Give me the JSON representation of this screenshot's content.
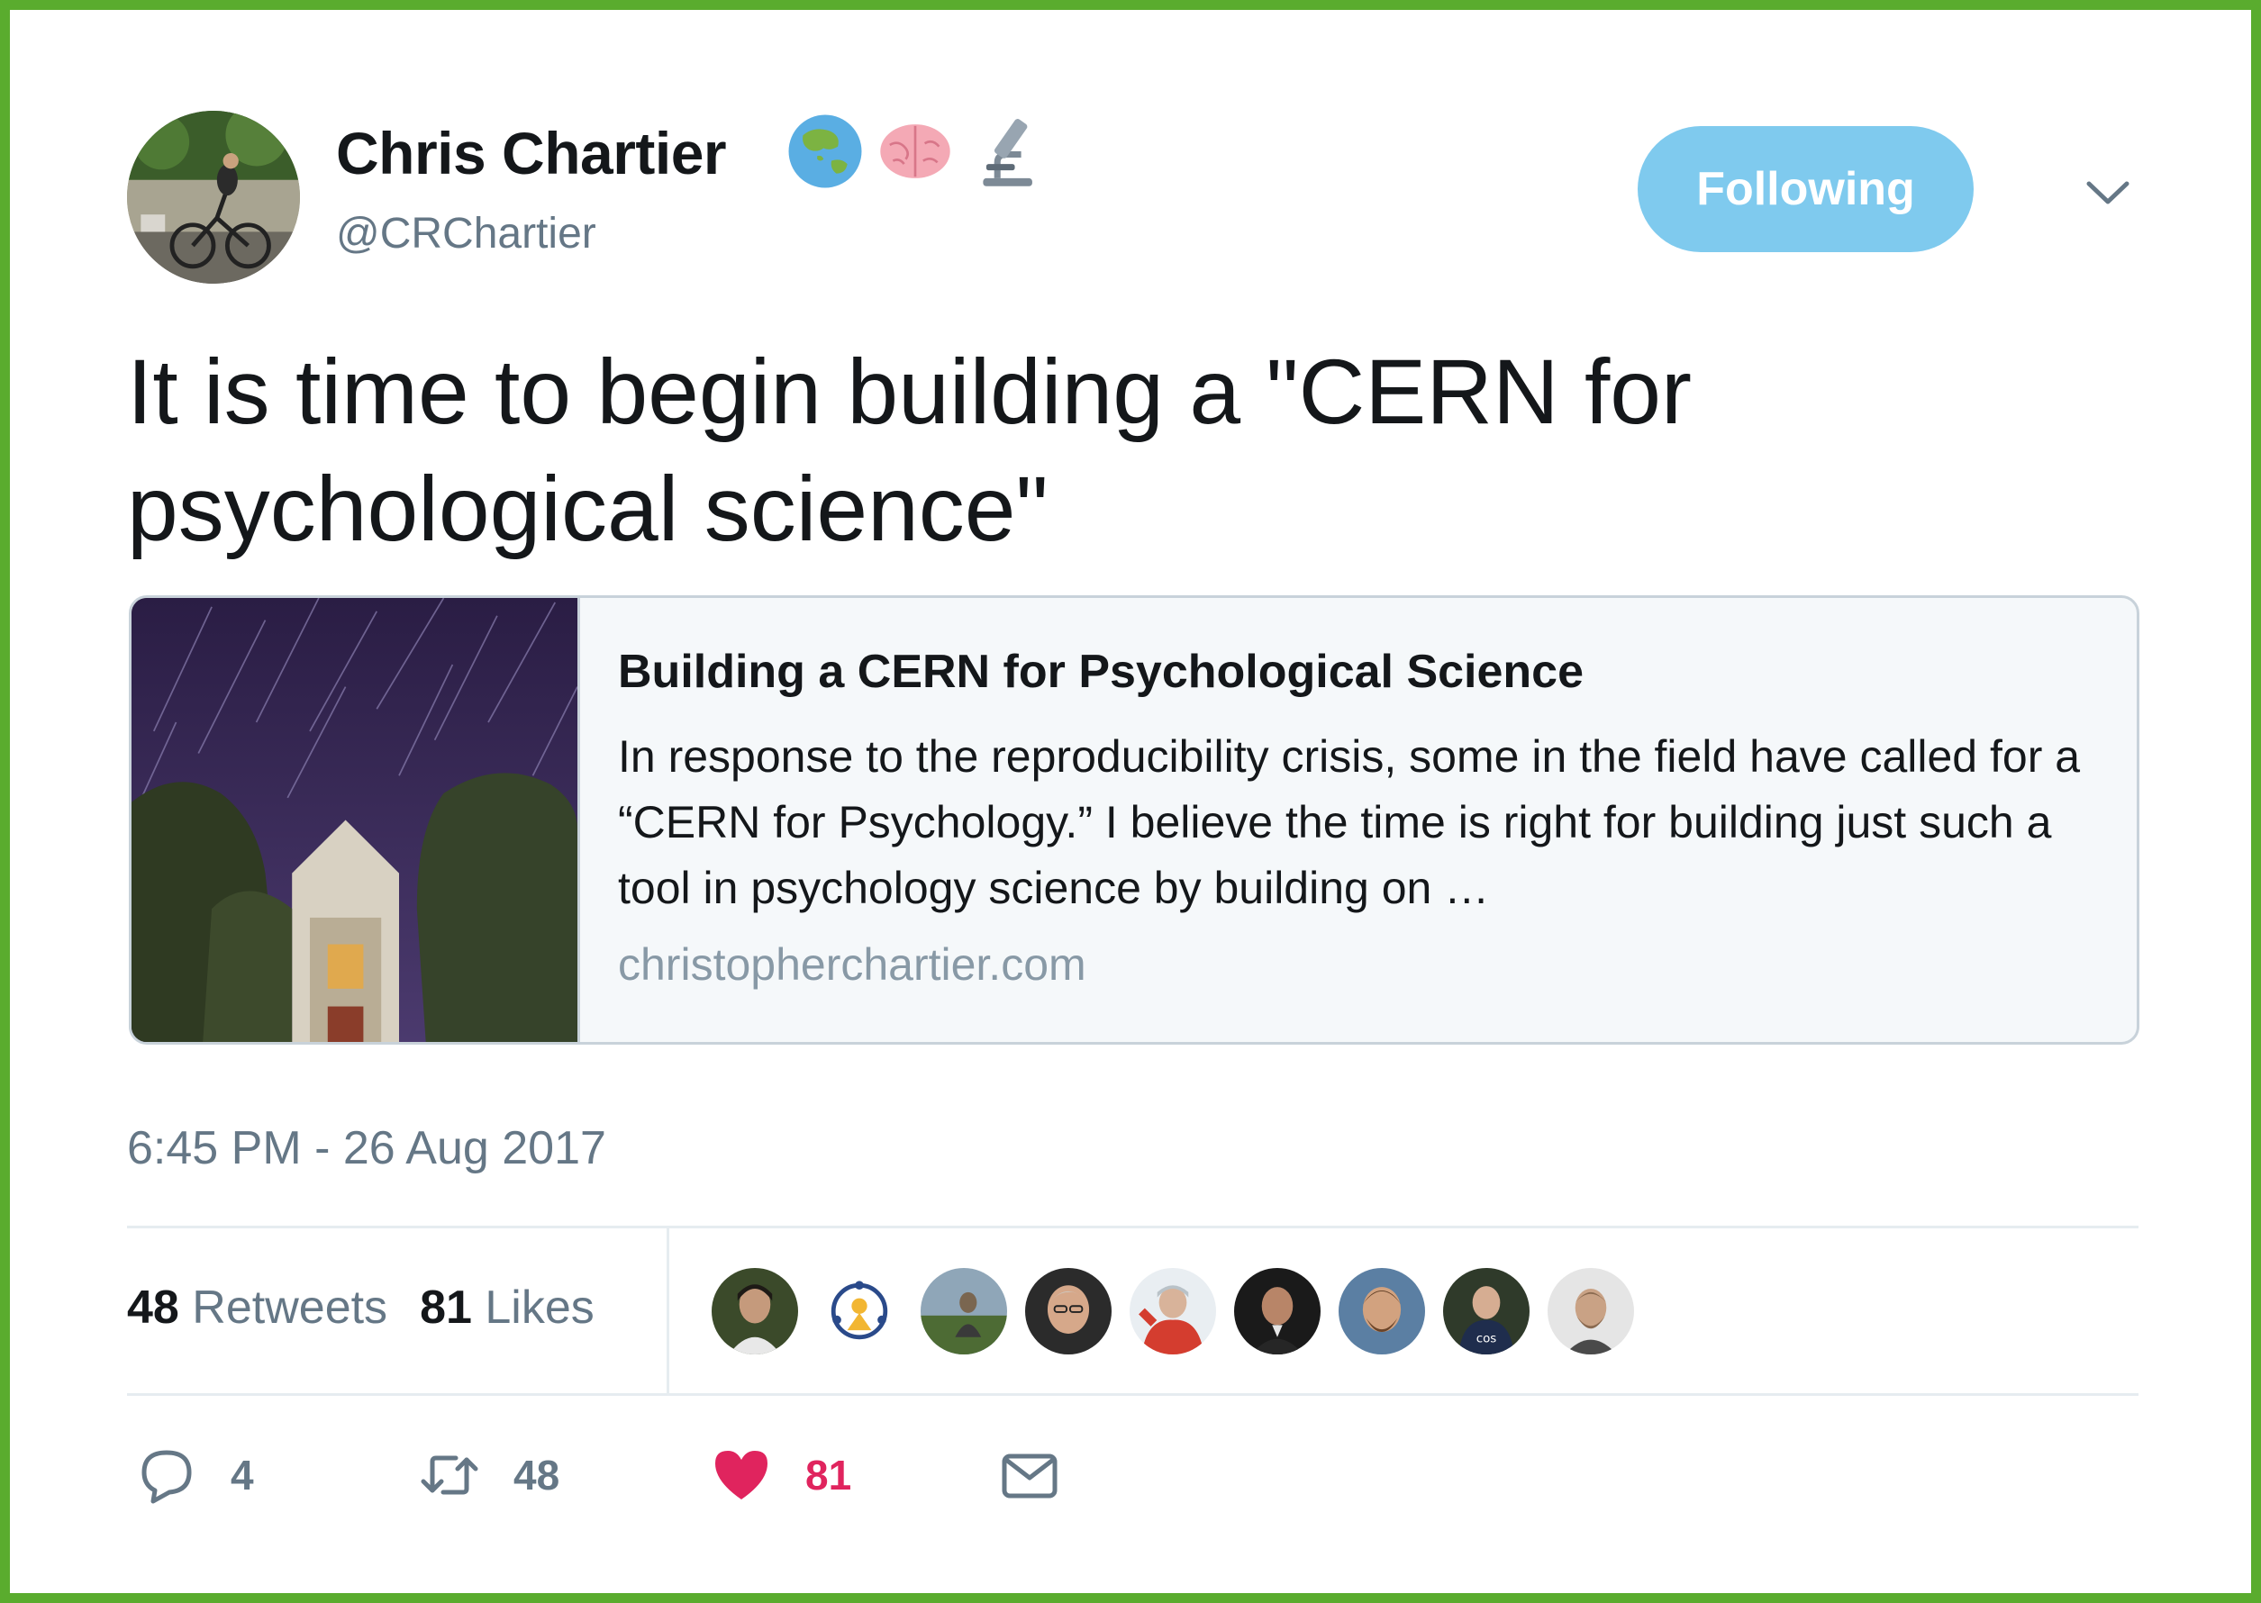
{
  "user": {
    "name": "Chris Chartier",
    "handle": "@CRChartier",
    "emojis": [
      "globe-asia-australia-emoji",
      "brain-emoji",
      "microscope-emoji"
    ]
  },
  "follow_button": {
    "label": "Following",
    "color": "#7fcaee"
  },
  "tweet": {
    "text": "It is time to begin building a \"CERN for psychological science\"",
    "timestamp": "6:45 PM - 26 Aug 2017"
  },
  "card": {
    "title": "Building a CERN for Psychological Science",
    "description": "In response to the reproducibility crisis, some in the field have called for a “CERN for Psychology.” I believe the time is right for building just such a tool in psychology science by building on …",
    "domain": "christopherchartier.com"
  },
  "stats": {
    "retweets_count": "48",
    "retweets_label": "Retweets",
    "likes_count": "81",
    "likes_label": "Likes"
  },
  "actions": {
    "reply_count": "4",
    "retweet_count": "48",
    "like_count": "81",
    "like_color": "#e0245e"
  },
  "frame_color": "#5aac2e"
}
